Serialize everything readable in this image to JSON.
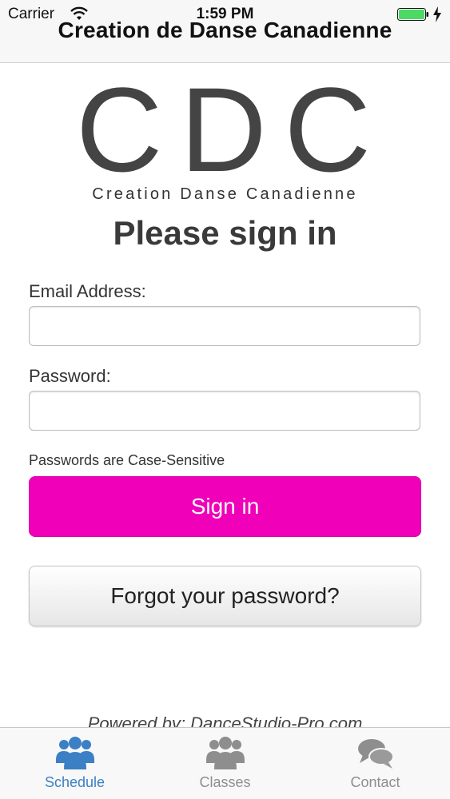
{
  "status_bar": {
    "carrier": "Carrier",
    "time": "1:59 PM",
    "icons": [
      "wifi-icon",
      "battery-icon",
      "charging-icon"
    ]
  },
  "header": {
    "title": "Creation de Danse Canadienne"
  },
  "logo": {
    "letters": "CDC",
    "subtitle": "Creation Danse Canadienne"
  },
  "form": {
    "heading": "Please sign in",
    "email_label": "Email Address:",
    "email_value": "",
    "password_label": "Password:",
    "password_value": "",
    "hint": "Passwords are Case-Sensitive",
    "signin_label": "Sign in",
    "forgot_label": "Forgot your password?"
  },
  "footer": {
    "powered_by": "Powered by: DanceStudio-Pro.com"
  },
  "tabbar": {
    "tabs": [
      {
        "label": "Schedule",
        "icon": "group-icon",
        "active": true
      },
      {
        "label": "Classes",
        "icon": "group-icon",
        "active": false
      },
      {
        "label": "Contact",
        "icon": "chat-bubbles-icon",
        "active": false
      }
    ]
  },
  "colors": {
    "accent": "#f000b8",
    "tab_active": "#3b7fc4",
    "tab_inactive": "#8e8e8e",
    "battery": "#4cd964"
  }
}
